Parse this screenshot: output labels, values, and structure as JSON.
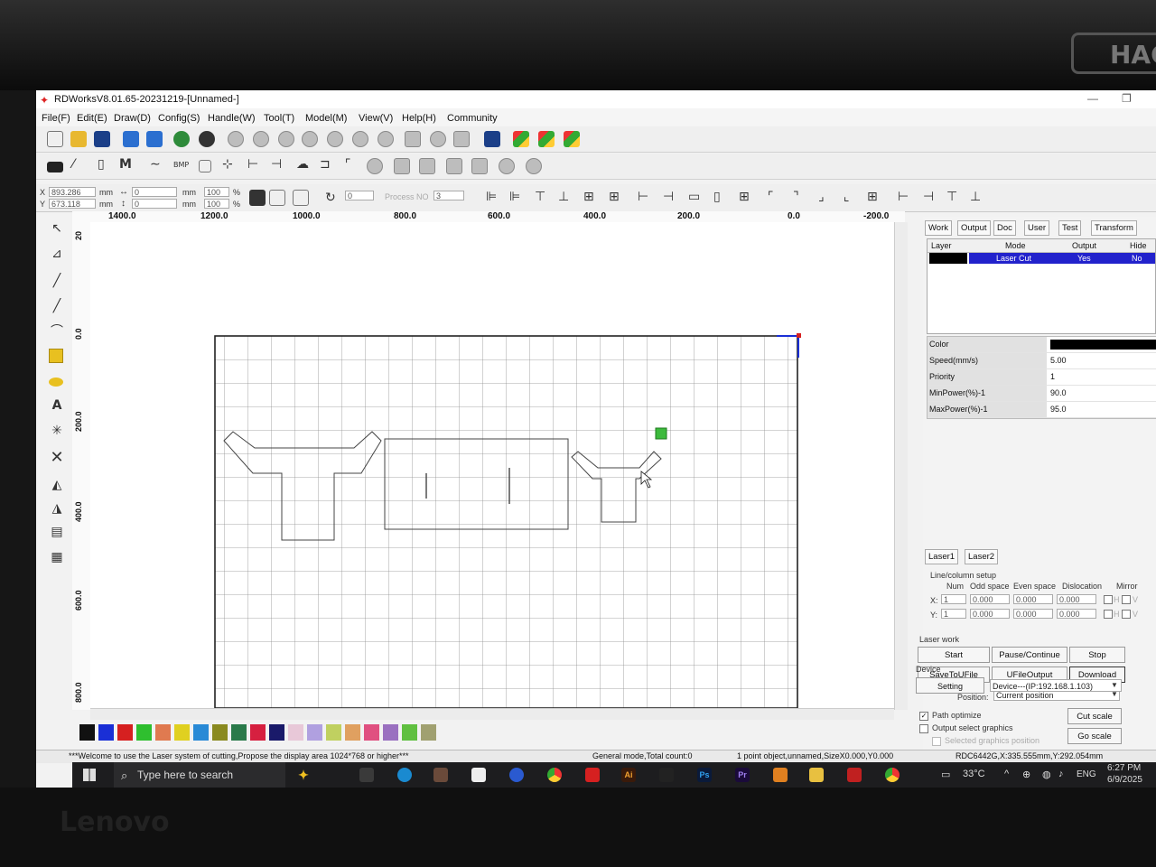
{
  "window": {
    "title": "RDWorksV8.01.65-20231219-[Unnamed-]"
  },
  "menu": [
    "File(F)",
    "Edit(E)",
    "Draw(D)",
    "Config(S)",
    "Handle(W)",
    "Tool(T)",
    "Model(M)",
    "View(V)",
    "Help(H)",
    "Community"
  ],
  "coords": {
    "x_label": "X",
    "y_label": "Y",
    "x_value": "893.286",
    "y_value": "673.118",
    "unit": "mm",
    "w_value": "0",
    "h_value": "0",
    "scale_w": "100",
    "scale_h": "100",
    "percent": "%",
    "angle_value": "0",
    "process_no_label": "Process NO",
    "process_no_value": "3"
  },
  "ruler": {
    "top": [
      "1400.0",
      "1200.0",
      "1000.0",
      "800.0",
      "600.0",
      "400.0",
      "200.0",
      "0.0",
      "-200.0"
    ],
    "left": [
      "20",
      "0.0",
      "200.0",
      "400.0",
      "600.0",
      "800.0"
    ]
  },
  "right_panel": {
    "tabs": [
      "Work",
      "Output",
      "Doc",
      "User",
      "Test",
      "Transform"
    ],
    "layer_headers": [
      "Layer",
      "Mode",
      "Output",
      "Hide"
    ],
    "layer_row": {
      "color": "#000000",
      "mode": "Laser Cut",
      "output": "Yes",
      "hide": "No"
    },
    "properties": [
      {
        "key": "Color",
        "value": ""
      },
      {
        "key": "Speed(mm/s)",
        "value": "5.00"
      },
      {
        "key": "Priority",
        "value": "1"
      },
      {
        "key": "MinPower(%)-1",
        "value": "90.0"
      },
      {
        "key": "MaxPower(%)-1",
        "value": "95.0"
      }
    ],
    "laser_tabs": [
      "Laser1",
      "Laser2"
    ],
    "line_column": {
      "title": "Line/column setup",
      "headers": [
        "Num",
        "Odd space",
        "Even space",
        "Dislocation",
        "Mirror"
      ],
      "x_label": "X:",
      "y_label": "Y:",
      "x_row": [
        "1",
        "0.000",
        "0.000",
        "0.000"
      ],
      "y_row": [
        "1",
        "0.000",
        "0.000",
        "0.000"
      ],
      "mirror_h": "H",
      "mirror_v": "V"
    },
    "laser_work": {
      "title": "Laser work",
      "start": "Start",
      "pause": "Pause/Continue",
      "stop": "Stop",
      "save_to_ufile": "SaveToUFile",
      "ufile_output": "UFileOutput",
      "download": "Download",
      "position_label": "Position:",
      "position_value": "Current position",
      "path_optimize": "Path optimize",
      "output_select": "Output select graphics",
      "selected_position": "Selected graphics position",
      "cut_scale": "Cut scale",
      "go_scale": "Go scale"
    },
    "device": {
      "title": "Device",
      "setting": "Setting",
      "device_value": "Device---(IP:192.168.1.103)"
    }
  },
  "palette": [
    "#111111",
    "#1a2fd6",
    "#d62020",
    "#2fbf2f",
    "#e07a50",
    "#e0d020",
    "#2a8ad6",
    "#8a8a20",
    "#2a7a4a",
    "#d62040",
    "#1a1a6a",
    "#e8c8d8",
    "#b0a0e0",
    "#c0d060",
    "#e0a060",
    "#e05080",
    "#9a70c0",
    "#60c040",
    "#a0a070"
  ],
  "status": {
    "welcome": "***Welcome to use the Laser system of cutting,Propose the display area 1024*768 or higher***",
    "mode": "General mode,Total count:0",
    "selection": "1 point object,unnamed,SizeX0.000,Y0.000",
    "machine": "RDC6442G,X:335.555mm,Y:292.054mm"
  },
  "taskbar": {
    "search_placeholder": "Type here to search",
    "temperature": "33°C",
    "language": "ENG",
    "time": "6:27 PM",
    "date": "6/9/2025",
    "apps": [
      "Ai",
      "Ps",
      "Pr"
    ]
  },
  "bezel": {
    "brand": "Lenovo",
    "badge": "HACK"
  }
}
